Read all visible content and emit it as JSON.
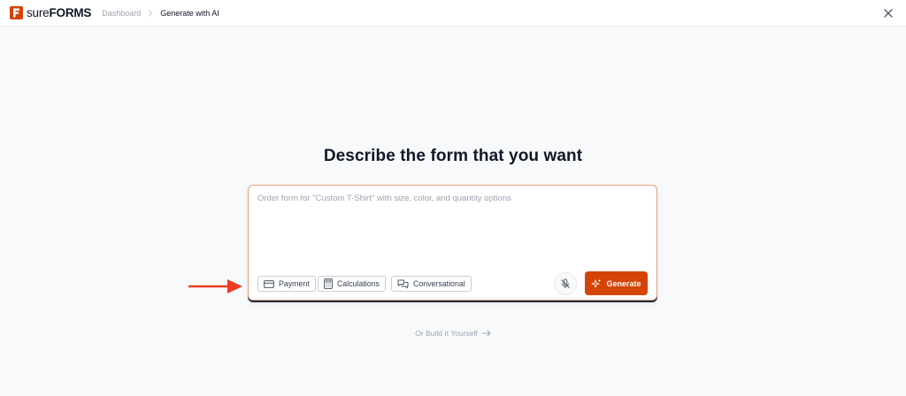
{
  "brand": {
    "logo_letter": "F",
    "name_light": "sure",
    "name_bold": "FORMS",
    "accent": "#d54407"
  },
  "breadcrumb": {
    "items": [
      "Dashboard",
      "Generate with AI"
    ],
    "separator_icon": "chevron-right-icon"
  },
  "header": {
    "close_icon": "close-icon"
  },
  "main": {
    "heading": "Describe the form that you want",
    "prompt": {
      "value": "",
      "placeholder": "Order form for \"Custom T-Shirt\" with size, color, and quantity options"
    },
    "chips": [
      {
        "label": "Payment",
        "icon": "credit-card-icon"
      },
      {
        "label": "Calculations",
        "icon": "calculator-icon"
      },
      {
        "label": "Conversational",
        "icon": "chat-bubbles-icon"
      }
    ],
    "mic_icon": "microphone-off-icon",
    "generate": {
      "label": "Generate",
      "icon": "sparkles-icon"
    },
    "build_link": {
      "label": "Or Build It Yourself",
      "icon": "arrow-right-icon"
    }
  },
  "annotation": {
    "arrow_color": "#ef3b22"
  }
}
